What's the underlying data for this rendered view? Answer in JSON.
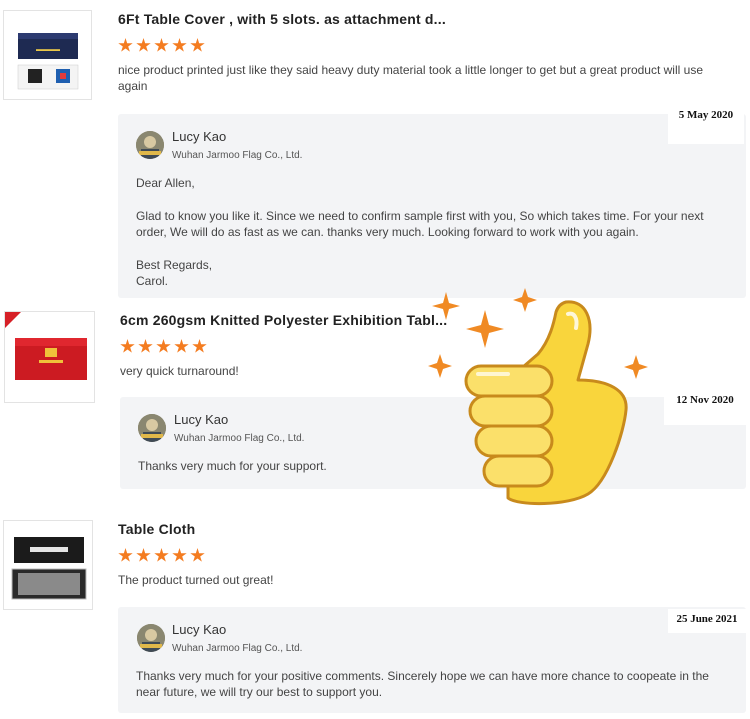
{
  "reviews": [
    {
      "product_title": "6Ft Table Cover , with 5 slots. as attachment d...",
      "rating": 5,
      "review_text": "nice product printed just like they said heavy duty material took a little longer to get but a great product will use again",
      "date": "5 May 2020",
      "reply": {
        "name": "Lucy Kao",
        "company": "Wuhan Jarmoo Flag Co., Ltd.",
        "lines": [
          "Dear Allen,",
          "",
          "Glad to know you like it.  Since we need to confirm sample first with you, So which takes time. For your next order, We will do as fast as we can.  thanks very much. Looking forward to work with you again.",
          "",
          "Best Regards,",
          "Carol."
        ]
      }
    },
    {
      "product_title": "6cm 260gsm Knitted Polyester Exhibition Tabl...",
      "rating": 5,
      "review_text": "very quick turnaround!",
      "date": "12 Nov 2020",
      "reply": {
        "name": "Lucy Kao",
        "company": "Wuhan Jarmoo Flag Co., Ltd.",
        "lines": [
          "Thanks very much for your support."
        ]
      }
    },
    {
      "product_title": "Table Cloth",
      "rating": 5,
      "review_text": "The product turned out great!",
      "date": "25 June 2021",
      "reply": {
        "name": "Lucy Kao",
        "company": "Wuhan Jarmoo Flag Co., Ltd.",
        "lines": [
          "Thanks very much for your positive comments.  Sincerely hope we can have more chance to coopeate in the near future, we will try our best to support you."
        ]
      }
    }
  ],
  "colors": {
    "star": "#f47c20",
    "reply_background": "#f3f4f6",
    "thumbs_up_yellow": "#f9d53c",
    "sparkle": "#f08a24"
  },
  "icons": {
    "rating": "star-icon",
    "sticker": "thumbs-up-icon",
    "sparkles": "sparkle-icon"
  }
}
